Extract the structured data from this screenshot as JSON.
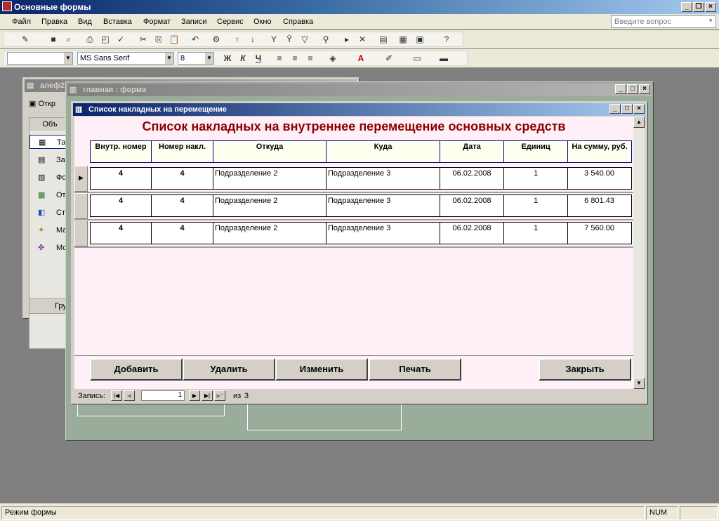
{
  "app": {
    "title": "Основные формы"
  },
  "menu": [
    "Файл",
    "Правка",
    "Вид",
    "Вставка",
    "Формат",
    "Записи",
    "Сервис",
    "Окно",
    "Справка"
  ],
  "ask_placeholder": "Введите вопрос",
  "format_toolbar": {
    "font": "MS Sans Serif",
    "size": "8"
  },
  "db_window": {
    "title": "алеф2",
    "open_label": "Откр",
    "objects_label": "Объ",
    "items": [
      "Та",
      "За",
      "Фо",
      "От",
      "Ст",
      "Ма",
      "Мо"
    ],
    "groups_label": "Гру"
  },
  "main_form": {
    "title": "главная : форма"
  },
  "list_form": {
    "title": "Список накладных на перемещение",
    "heading": "Список накладных на внутреннее перемещение основных средств",
    "columns": [
      "Внутр. номер",
      "Номер накл.",
      "Откуда",
      "Куда",
      "Дата",
      "Единиц",
      "На сумму, руб."
    ],
    "rows": [
      {
        "internal": "4",
        "number": "4",
        "from": "Подразделение 2",
        "to": "Подразделение 3",
        "date": "06.02.2008",
        "units": "1",
        "sum": "3 540.00"
      },
      {
        "internal": "4",
        "number": "4",
        "from": "Подразделение 2",
        "to": "Подразделение 3",
        "date": "06.02.2008",
        "units": "1",
        "sum": "6 801.43"
      },
      {
        "internal": "4",
        "number": "4",
        "from": "Подразделение 2",
        "to": "Подразделение 3",
        "date": "06.02.2008",
        "units": "1",
        "sum": "7 560.00"
      }
    ],
    "buttons": {
      "add": "Добавить",
      "delete": "Удалить",
      "edit": "Изменить",
      "print": "Печать",
      "close": "Закрыть"
    },
    "nav": {
      "label": "Запись:",
      "current": "1",
      "of_label": "из",
      "total": "3"
    }
  },
  "status": {
    "mode": "Режим формы",
    "num": "NUM"
  },
  "colors": {
    "heading": "#8b0000",
    "form_bg": "#fff0f8",
    "header_bg": "#fffff0",
    "title_active": "#0a246a"
  }
}
